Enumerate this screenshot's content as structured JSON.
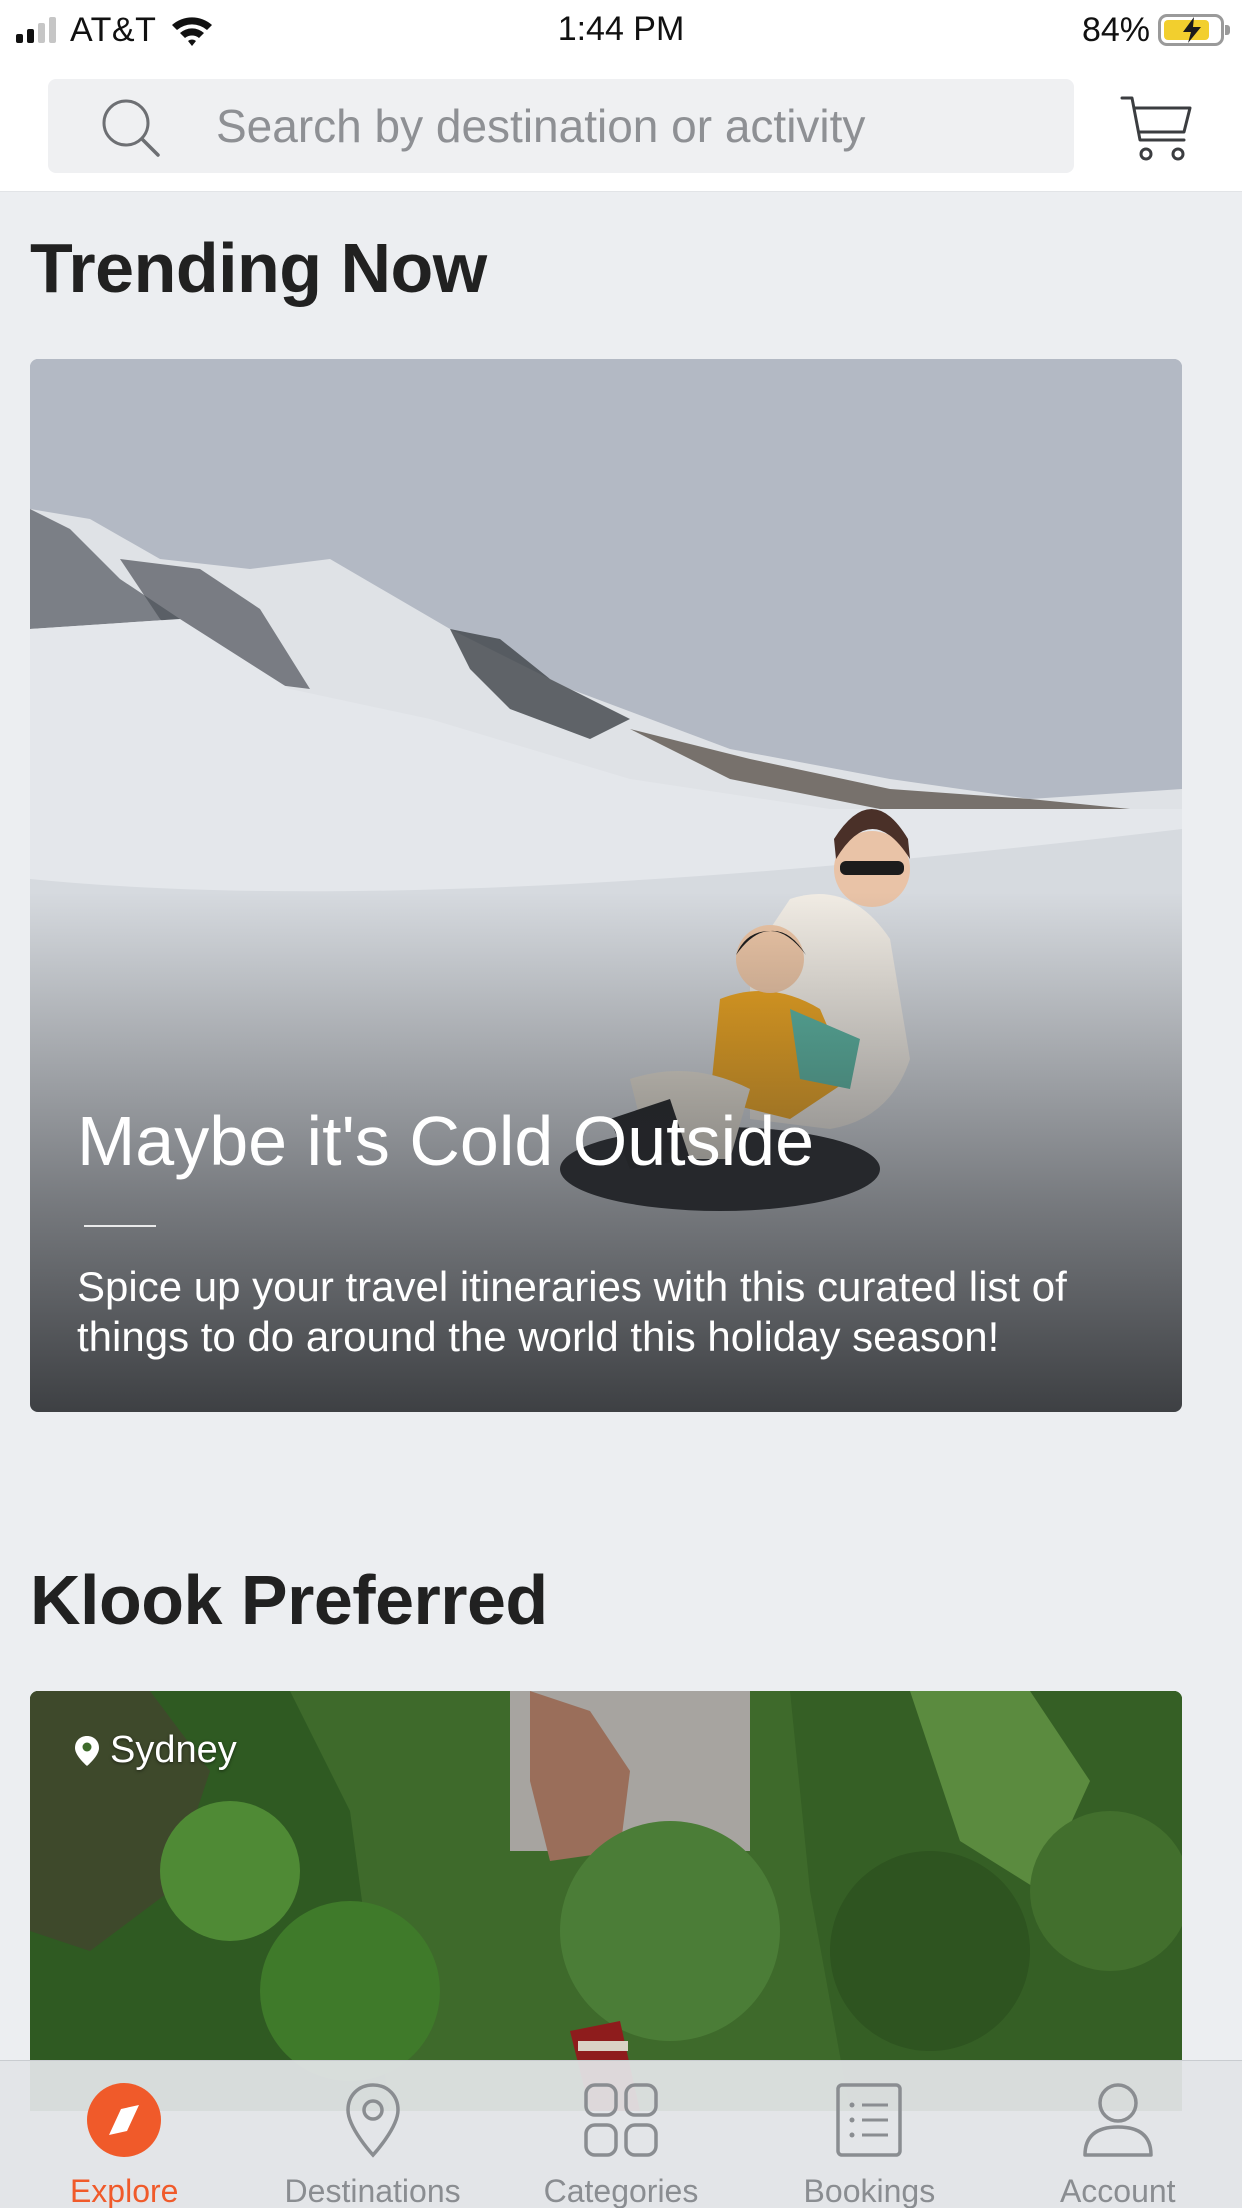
{
  "status_bar": {
    "carrier": "AT&T",
    "time": "1:44 PM",
    "battery_percent": "84%",
    "battery_level": 0.84,
    "icons": [
      "signal-icon",
      "wifi-icon",
      "battery-charging-icon"
    ]
  },
  "header": {
    "search_placeholder": "Search by destination or activity",
    "icons": [
      "search-icon",
      "cart-icon"
    ]
  },
  "trending": {
    "title": "Trending Now",
    "card": {
      "title": "Maybe it's Cold Outside",
      "description": "Spice up your travel itineraries with this curated list of things to do around the world this holiday season!"
    }
  },
  "preferred": {
    "title": "Klook Preferred",
    "card": {
      "location": "Sydney",
      "icon": "location-pin-icon"
    }
  },
  "tab_bar": {
    "active": "Explore",
    "accent_color": "#f05a2a",
    "tabs": [
      {
        "label": "Explore",
        "icon": "compass-icon"
      },
      {
        "label": "Destinations",
        "icon": "map-pin-icon"
      },
      {
        "label": "Categories",
        "icon": "grid-icon"
      },
      {
        "label": "Bookings",
        "icon": "list-icon"
      },
      {
        "label": "Account",
        "icon": "person-icon"
      }
    ]
  }
}
